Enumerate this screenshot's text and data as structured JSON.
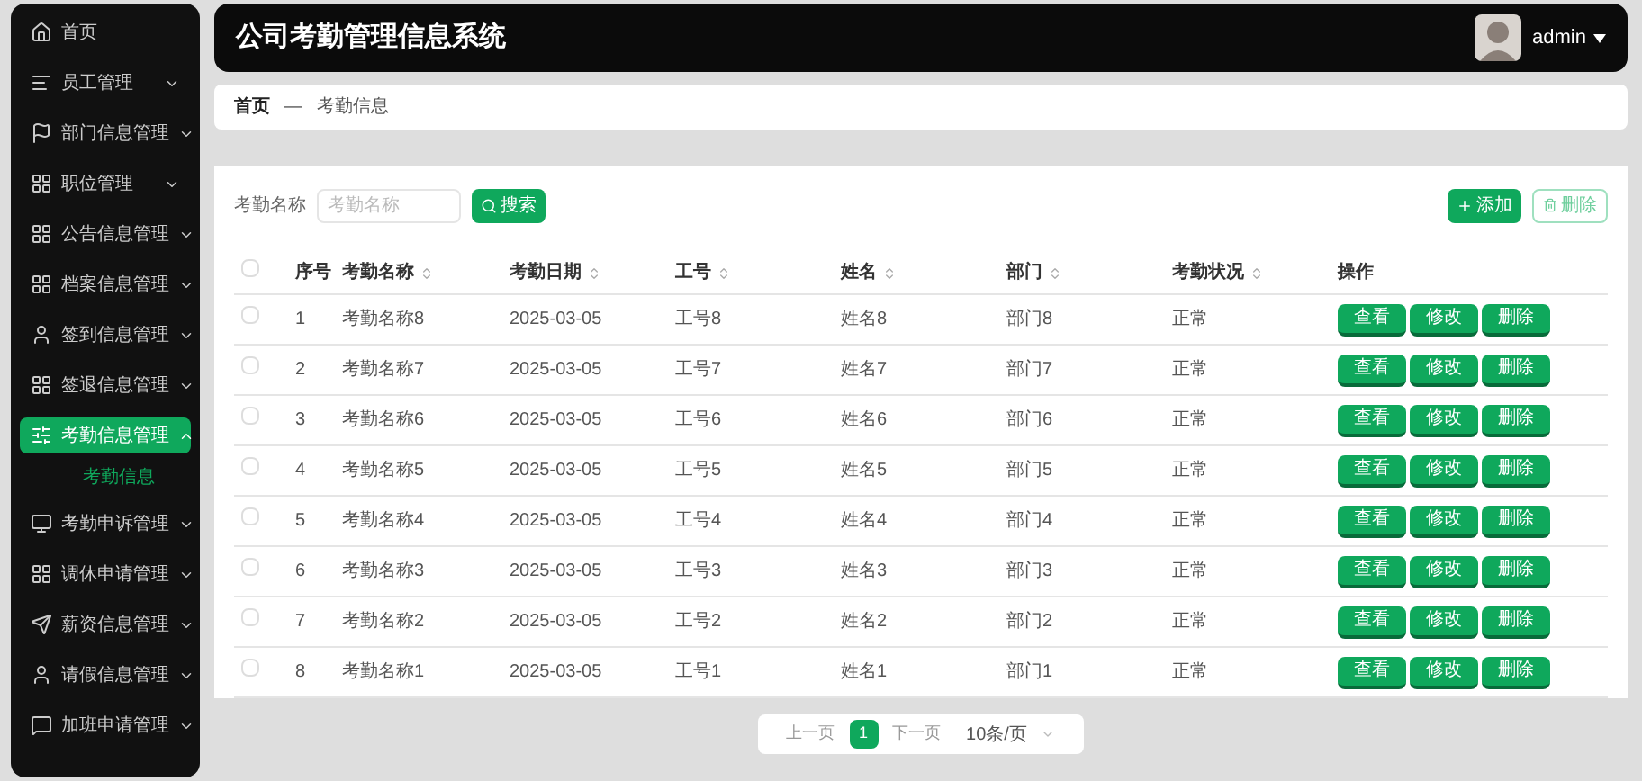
{
  "sidebar": {
    "items": [
      {
        "label": "首页",
        "has_children": false,
        "selected": false
      },
      {
        "label": "员工管理",
        "has_children": true,
        "expanded": false,
        "selected": false
      },
      {
        "label": "部门信息管理",
        "has_children": true,
        "expanded": false,
        "selected": false
      },
      {
        "label": "职位管理",
        "has_children": true,
        "expanded": false,
        "selected": false
      },
      {
        "label": "公告信息管理",
        "has_children": true,
        "expanded": false,
        "selected": false
      },
      {
        "label": "档案信息管理",
        "has_children": true,
        "expanded": false,
        "selected": false
      },
      {
        "label": "签到信息管理",
        "has_children": true,
        "expanded": false,
        "selected": false
      },
      {
        "label": "签退信息管理",
        "has_children": true,
        "expanded": false,
        "selected": false
      },
      {
        "label": "考勤信息管理",
        "has_children": true,
        "expanded": true,
        "selected": true,
        "children": [
          {
            "label": "考勤信息",
            "selected": true
          }
        ]
      },
      {
        "label": "考勤申诉管理",
        "has_children": true,
        "expanded": false,
        "selected": false
      },
      {
        "label": "调休申请管理",
        "has_children": true,
        "expanded": false,
        "selected": false
      },
      {
        "label": "薪资信息管理",
        "has_children": true,
        "expanded": false,
        "selected": false
      },
      {
        "label": "请假信息管理",
        "has_children": true,
        "expanded": false,
        "selected": false
      },
      {
        "label": "加班申请管理",
        "has_children": true,
        "expanded": false,
        "selected": false
      }
    ]
  },
  "header": {
    "title": "公司考勤管理信息系统",
    "user": "admin"
  },
  "breadcrumb": [
    "首页",
    "—",
    "考勤信息"
  ],
  "search": {
    "label": "考勤名称",
    "placeholder": "考勤名称",
    "button": "搜索"
  },
  "actions": {
    "add": "添加",
    "delete": "删除"
  },
  "table": {
    "header_checked": false,
    "columns": [
      {
        "label": "序号",
        "sortable": false
      },
      {
        "label": "考勤名称",
        "sortable": true
      },
      {
        "label": "考勤日期",
        "sortable": true
      },
      {
        "label": "工号",
        "sortable": true
      },
      {
        "label": "姓名",
        "sortable": true
      },
      {
        "label": "部门",
        "sortable": true
      },
      {
        "label": "考勤状况",
        "sortable": true
      },
      {
        "label": "操作",
        "sortable": false
      }
    ],
    "rows": [
      {
        "checked": false,
        "cells": [
          "1",
          "考勤名称8",
          "2025-03-05",
          "工号8",
          "姓名8",
          "部门8",
          "正常"
        ],
        "buttons": [
          "查看",
          "修改",
          "删除"
        ]
      },
      {
        "checked": false,
        "cells": [
          "2",
          "考勤名称7",
          "2025-03-05",
          "工号7",
          "姓名7",
          "部门7",
          "正常"
        ],
        "buttons": [
          "查看",
          "修改",
          "删除"
        ]
      },
      {
        "checked": false,
        "cells": [
          "3",
          "考勤名称6",
          "2025-03-05",
          "工号6",
          "姓名6",
          "部门6",
          "正常"
        ],
        "buttons": [
          "查看",
          "修改",
          "删除"
        ]
      },
      {
        "checked": false,
        "cells": [
          "4",
          "考勤名称5",
          "2025-03-05",
          "工号5",
          "姓名5",
          "部门5",
          "正常"
        ],
        "buttons": [
          "查看",
          "修改",
          "删除"
        ]
      },
      {
        "checked": false,
        "cells": [
          "5",
          "考勤名称4",
          "2025-03-05",
          "工号4",
          "姓名4",
          "部门4",
          "正常"
        ],
        "buttons": [
          "查看",
          "修改",
          "删除"
        ]
      },
      {
        "checked": false,
        "cells": [
          "6",
          "考勤名称3",
          "2025-03-05",
          "工号3",
          "姓名3",
          "部门3",
          "正常"
        ],
        "buttons": [
          "查看",
          "修改",
          "删除"
        ]
      },
      {
        "checked": false,
        "cells": [
          "7",
          "考勤名称2",
          "2025-03-05",
          "工号2",
          "姓名2",
          "部门2",
          "正常"
        ],
        "buttons": [
          "查看",
          "修改",
          "删除"
        ]
      },
      {
        "checked": false,
        "cells": [
          "8",
          "考勤名称1",
          "2025-03-05",
          "工号1",
          "姓名1",
          "部门1",
          "正常"
        ],
        "buttons": [
          "查看",
          "修改",
          "删除"
        ]
      }
    ]
  },
  "pagination": {
    "prev": "上一页",
    "pages": [
      {
        "label": "1",
        "selected": true
      }
    ],
    "next": "下一页",
    "page_size": "10条/页"
  }
}
